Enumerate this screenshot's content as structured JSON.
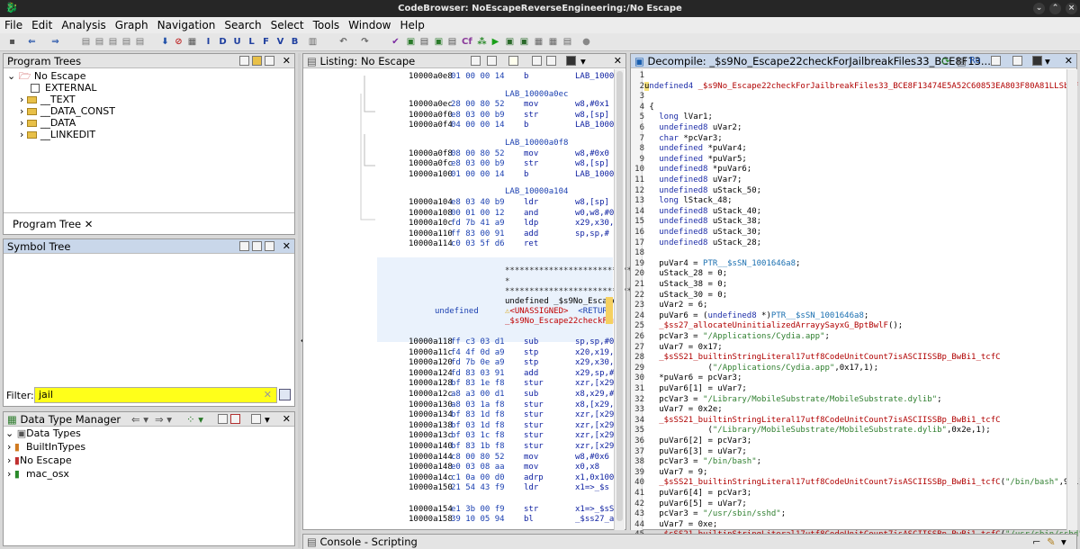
{
  "window": {
    "title": "CodeBrowser: NoEscapeReverseEngineering:/No Escape"
  },
  "menu": [
    "File",
    "Edit",
    "Analysis",
    "Graph",
    "Navigation",
    "Search",
    "Select",
    "Tools",
    "Window",
    "Help"
  ],
  "toolbar": {
    "letters": [
      "I",
      "D",
      "U",
      "L",
      "F",
      "V",
      "B"
    ]
  },
  "program_trees": {
    "title": "Program Trees",
    "items": [
      "No Escape",
      "EXTERNAL",
      "__TEXT",
      "__DATA_CONST",
      "__DATA",
      "__LINKEDIT"
    ],
    "tab": "Program Tree"
  },
  "symbol_tree": {
    "title": "Symbol Tree",
    "filter_label": "Filter:",
    "filter_value": "jail"
  },
  "data_types": {
    "title": "Data Type Manager",
    "items": [
      "Data Types",
      "BuiltInTypes",
      "No Escape",
      "mac_osx"
    ]
  },
  "listing": {
    "title": "Listing:  No Escape",
    "rows": [
      {
        "addr": "10000a0e8",
        "bytes": "01 00 00 14",
        "mnem": "b",
        "op": "LAB_1000"
      },
      {
        "label": "LAB_10000a0ec"
      },
      {
        "addr": "10000a0ec",
        "bytes": "28 00 80 52",
        "mnem": "mov",
        "op": "w8,#0x1"
      },
      {
        "addr": "10000a0f0",
        "bytes": "e8 03 00 b9",
        "mnem": "str",
        "op": "w8,[sp]"
      },
      {
        "addr": "10000a0f4",
        "bytes": "04 00 00 14",
        "mnem": "b",
        "op": "LAB_1000"
      },
      {
        "label": "LAB_10000a0f8"
      },
      {
        "addr": "10000a0f8",
        "bytes": "08 00 80 52",
        "mnem": "mov",
        "op": "w8,#0x0"
      },
      {
        "addr": "10000a0fc",
        "bytes": "e8 03 00 b9",
        "mnem": "str",
        "op": "w8,[sp]"
      },
      {
        "addr": "10000a100",
        "bytes": "01 00 00 14",
        "mnem": "b",
        "op": "LAB_1000"
      },
      {
        "label": "LAB_10000a104"
      },
      {
        "addr": "10000a104",
        "bytes": "e8 03 40 b9",
        "mnem": "ldr",
        "op": "w8,[sp]"
      },
      {
        "addr": "10000a108",
        "bytes": "00 01 00 12",
        "mnem": "and",
        "op": "w0,w8,#0"
      },
      {
        "addr": "10000a10c",
        "bytes": "fd 7b 41 a9",
        "mnem": "ldp",
        "op": "x29,x30,"
      },
      {
        "addr": "10000a110",
        "bytes": "ff 83 00 91",
        "mnem": "add",
        "op": "sp,sp,#"
      },
      {
        "addr": "10000a114",
        "bytes": "c0 03 5f d6",
        "mnem": "ret",
        "op": ""
      }
    ],
    "func_header": {
      "stars": "**************************",
      "undefined": "undefined",
      "sig": "undefined _$s9No_Escape2",
      "unassigned": "<UNASSIGNED>",
      "ret": "<RETURN",
      "name": "_$s9No_Escape22checkFor"
    },
    "rows2": [
      {
        "addr": "10000a118",
        "bytes": "ff c3 03 d1",
        "mnem": "sub",
        "op": "sp,sp,#0"
      },
      {
        "addr": "10000a11c",
        "bytes": "f4 4f 0d a9",
        "mnem": "stp",
        "op": "x20,x19,"
      },
      {
        "addr": "10000a120",
        "bytes": "fd 7b 0e a9",
        "mnem": "stp",
        "op": "x29,x30,"
      },
      {
        "addr": "10000a124",
        "bytes": "fd 83 03 91",
        "mnem": "add",
        "op": "x29,sp,#"
      },
      {
        "addr": "10000a128",
        "bytes": "bf 83 1e f8",
        "mnem": "stur",
        "op": "xzr,[x29"
      },
      {
        "addr": "10000a12c",
        "bytes": "a8 a3 00 d1",
        "mnem": "sub",
        "op": "x8,x29,#"
      },
      {
        "addr": "10000a130",
        "bytes": "a8 03 1a f8",
        "mnem": "stur",
        "op": "x8,[x29,"
      },
      {
        "addr": "10000a134",
        "bytes": "bf 83 1d f8",
        "mnem": "stur",
        "op": "xzr,[x29"
      },
      {
        "addr": "10000a138",
        "bytes": "bf 03 1d f8",
        "mnem": "stur",
        "op": "xzr,[x29"
      },
      {
        "addr": "10000a13c",
        "bytes": "bf 03 1c f8",
        "mnem": "stur",
        "op": "xzr,[x29"
      },
      {
        "addr": "10000a140",
        "bytes": "bf 83 1b f8",
        "mnem": "stur",
        "op": "xzr,[x29"
      },
      {
        "addr": "10000a144",
        "bytes": "c8 00 80 52",
        "mnem": "mov",
        "op": "w8,#0x6"
      },
      {
        "addr": "10000a148",
        "bytes": "e0 03 08 aa",
        "mnem": "mov",
        "op": "x0,x8"
      },
      {
        "addr": "10000a14c",
        "bytes": "c1 0a 00 d0",
        "mnem": "adrp",
        "op": "x1,0x100"
      },
      {
        "addr": "10000a150",
        "bytes": "21 54 43 f9",
        "mnem": "ldr",
        "op": "x1=>_$s"
      },
      {
        "addr": "",
        "bytes": "",
        "mnem": "",
        "op": ""
      },
      {
        "addr": "10000a154",
        "bytes": "e1 3b 00 f9",
        "mnem": "str",
        "op": "x1=>_$sS"
      },
      {
        "addr": "10000a158",
        "bytes": "39 10 05 94",
        "mnem": "bl",
        "op": "_$ss27_a"
      }
    ]
  },
  "decompile": {
    "title": "Decompile: _$s9No_Escape22checkForJailbreakFiles33_BCE8F13...",
    "lines": [
      "",
      "undefined4 _$s9No_Escape22checkForJailbreakFiles33_BCE8F13474E5A52C60853EA803F80A81LLSbyF(void)",
      "",
      "{",
      "  long lVar1;",
      "  undefined8 uVar2;",
      "  char *pcVar3;",
      "  undefined *puVar4;",
      "  undefined *puVar5;",
      "  undefined8 *puVar6;",
      "  undefined8 uVar7;",
      "  undefined8 uStack_50;",
      "  long lStack_48;",
      "  undefined8 uStack_40;",
      "  undefined8 uStack_38;",
      "  undefined8 uStack_30;",
      "  undefined8 uStack_28;",
      "",
      "  puVar4 = PTR__$sSN_1001646a8;",
      "  uStack_28 = 0;",
      "  uStack_38 = 0;",
      "  uStack_30 = 0;",
      "  uVar2 = 6;",
      "  puVar6 = (undefined8 *)PTR__$sSN_1001646a8;",
      "  _$ss27_allocateUninitializedArrayySayxG_BptBwlF();",
      "  pcVar3 = \"/Applications/Cydia.app\";",
      "  uVar7 = 0x17;",
      "  _$sSS21_builtinStringLiteral17utf8CodeUnitCount7isASCIISSBp_BwBi1_tcfC",
      "            (\"/Applications/Cydia.app\",0x17,1);",
      "  *puVar6 = pcVar3;",
      "  puVar6[1] = uVar7;",
      "  pcVar3 = \"/Library/MobileSubstrate/MobileSubstrate.dylib\";",
      "  uVar7 = 0x2e;",
      "  _$sSS21_builtinStringLiteral17utf8CodeUnitCount7isASCIISSBp_BwBi1_tcfC",
      "            (\"/Library/MobileSubstrate/MobileSubstrate.dylib\",0x2e,1);",
      "  puVar6[2] = pcVar3;",
      "  puVar6[3] = uVar7;",
      "  pcVar3 = \"/bin/bash\";",
      "  uVar7 = 9;",
      "  _$sSS21_builtinStringLiteral17utf8CodeUnitCount7isASCIISSBp_BwBi1_tcfC(\"/bin/bash\",9,1);",
      "  puVar6[4] = pcVar3;",
      "  puVar6[5] = uVar7;",
      "  pcVar3 = \"/usr/sbin/sshd\";",
      "  uVar7 = 0xe;",
      "  _$sSS21_builtinStringLiteral17utf8CodeUnitCount7isASCIISSBp_BwBi1_tcfC(\"/usr/sbin/sshd\",0xe,1)"
    ]
  },
  "console": {
    "title": "Console - Scripting"
  }
}
